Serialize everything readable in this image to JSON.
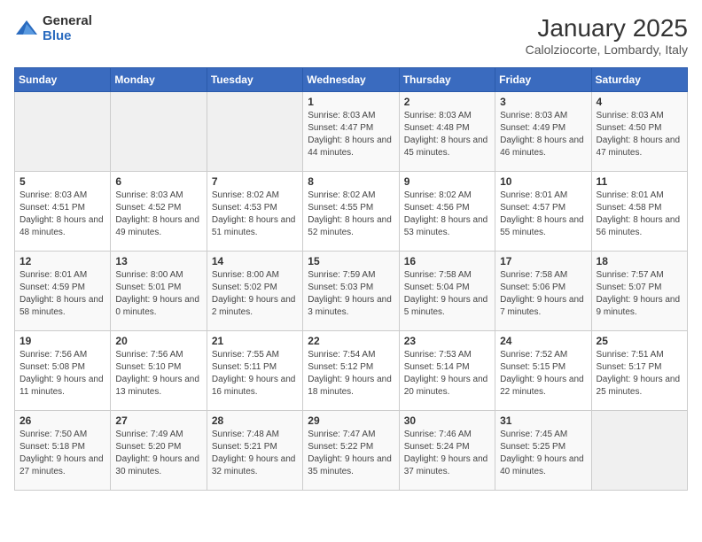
{
  "header": {
    "logo_general": "General",
    "logo_blue": "Blue",
    "month_title": "January 2025",
    "location": "Calolziocorte, Lombardy, Italy"
  },
  "weekdays": [
    "Sunday",
    "Monday",
    "Tuesday",
    "Wednesday",
    "Thursday",
    "Friday",
    "Saturday"
  ],
  "weeks": [
    [
      {
        "day": "",
        "sunrise": "",
        "sunset": "",
        "daylight": ""
      },
      {
        "day": "",
        "sunrise": "",
        "sunset": "",
        "daylight": ""
      },
      {
        "day": "",
        "sunrise": "",
        "sunset": "",
        "daylight": ""
      },
      {
        "day": "1",
        "sunrise": "Sunrise: 8:03 AM",
        "sunset": "Sunset: 4:47 PM",
        "daylight": "Daylight: 8 hours and 44 minutes."
      },
      {
        "day": "2",
        "sunrise": "Sunrise: 8:03 AM",
        "sunset": "Sunset: 4:48 PM",
        "daylight": "Daylight: 8 hours and 45 minutes."
      },
      {
        "day": "3",
        "sunrise": "Sunrise: 8:03 AM",
        "sunset": "Sunset: 4:49 PM",
        "daylight": "Daylight: 8 hours and 46 minutes."
      },
      {
        "day": "4",
        "sunrise": "Sunrise: 8:03 AM",
        "sunset": "Sunset: 4:50 PM",
        "daylight": "Daylight: 8 hours and 47 minutes."
      }
    ],
    [
      {
        "day": "5",
        "sunrise": "Sunrise: 8:03 AM",
        "sunset": "Sunset: 4:51 PM",
        "daylight": "Daylight: 8 hours and 48 minutes."
      },
      {
        "day": "6",
        "sunrise": "Sunrise: 8:03 AM",
        "sunset": "Sunset: 4:52 PM",
        "daylight": "Daylight: 8 hours and 49 minutes."
      },
      {
        "day": "7",
        "sunrise": "Sunrise: 8:02 AM",
        "sunset": "Sunset: 4:53 PM",
        "daylight": "Daylight: 8 hours and 51 minutes."
      },
      {
        "day": "8",
        "sunrise": "Sunrise: 8:02 AM",
        "sunset": "Sunset: 4:55 PM",
        "daylight": "Daylight: 8 hours and 52 minutes."
      },
      {
        "day": "9",
        "sunrise": "Sunrise: 8:02 AM",
        "sunset": "Sunset: 4:56 PM",
        "daylight": "Daylight: 8 hours and 53 minutes."
      },
      {
        "day": "10",
        "sunrise": "Sunrise: 8:01 AM",
        "sunset": "Sunset: 4:57 PM",
        "daylight": "Daylight: 8 hours and 55 minutes."
      },
      {
        "day": "11",
        "sunrise": "Sunrise: 8:01 AM",
        "sunset": "Sunset: 4:58 PM",
        "daylight": "Daylight: 8 hours and 56 minutes."
      }
    ],
    [
      {
        "day": "12",
        "sunrise": "Sunrise: 8:01 AM",
        "sunset": "Sunset: 4:59 PM",
        "daylight": "Daylight: 8 hours and 58 minutes."
      },
      {
        "day": "13",
        "sunrise": "Sunrise: 8:00 AM",
        "sunset": "Sunset: 5:01 PM",
        "daylight": "Daylight: 9 hours and 0 minutes."
      },
      {
        "day": "14",
        "sunrise": "Sunrise: 8:00 AM",
        "sunset": "Sunset: 5:02 PM",
        "daylight": "Daylight: 9 hours and 2 minutes."
      },
      {
        "day": "15",
        "sunrise": "Sunrise: 7:59 AM",
        "sunset": "Sunset: 5:03 PM",
        "daylight": "Daylight: 9 hours and 3 minutes."
      },
      {
        "day": "16",
        "sunrise": "Sunrise: 7:58 AM",
        "sunset": "Sunset: 5:04 PM",
        "daylight": "Daylight: 9 hours and 5 minutes."
      },
      {
        "day": "17",
        "sunrise": "Sunrise: 7:58 AM",
        "sunset": "Sunset: 5:06 PM",
        "daylight": "Daylight: 9 hours and 7 minutes."
      },
      {
        "day": "18",
        "sunrise": "Sunrise: 7:57 AM",
        "sunset": "Sunset: 5:07 PM",
        "daylight": "Daylight: 9 hours and 9 minutes."
      }
    ],
    [
      {
        "day": "19",
        "sunrise": "Sunrise: 7:56 AM",
        "sunset": "Sunset: 5:08 PM",
        "daylight": "Daylight: 9 hours and 11 minutes."
      },
      {
        "day": "20",
        "sunrise": "Sunrise: 7:56 AM",
        "sunset": "Sunset: 5:10 PM",
        "daylight": "Daylight: 9 hours and 13 minutes."
      },
      {
        "day": "21",
        "sunrise": "Sunrise: 7:55 AM",
        "sunset": "Sunset: 5:11 PM",
        "daylight": "Daylight: 9 hours and 16 minutes."
      },
      {
        "day": "22",
        "sunrise": "Sunrise: 7:54 AM",
        "sunset": "Sunset: 5:12 PM",
        "daylight": "Daylight: 9 hours and 18 minutes."
      },
      {
        "day": "23",
        "sunrise": "Sunrise: 7:53 AM",
        "sunset": "Sunset: 5:14 PM",
        "daylight": "Daylight: 9 hours and 20 minutes."
      },
      {
        "day": "24",
        "sunrise": "Sunrise: 7:52 AM",
        "sunset": "Sunset: 5:15 PM",
        "daylight": "Daylight: 9 hours and 22 minutes."
      },
      {
        "day": "25",
        "sunrise": "Sunrise: 7:51 AM",
        "sunset": "Sunset: 5:17 PM",
        "daylight": "Daylight: 9 hours and 25 minutes."
      }
    ],
    [
      {
        "day": "26",
        "sunrise": "Sunrise: 7:50 AM",
        "sunset": "Sunset: 5:18 PM",
        "daylight": "Daylight: 9 hours and 27 minutes."
      },
      {
        "day": "27",
        "sunrise": "Sunrise: 7:49 AM",
        "sunset": "Sunset: 5:20 PM",
        "daylight": "Daylight: 9 hours and 30 minutes."
      },
      {
        "day": "28",
        "sunrise": "Sunrise: 7:48 AM",
        "sunset": "Sunset: 5:21 PM",
        "daylight": "Daylight: 9 hours and 32 minutes."
      },
      {
        "day": "29",
        "sunrise": "Sunrise: 7:47 AM",
        "sunset": "Sunset: 5:22 PM",
        "daylight": "Daylight: 9 hours and 35 minutes."
      },
      {
        "day": "30",
        "sunrise": "Sunrise: 7:46 AM",
        "sunset": "Sunset: 5:24 PM",
        "daylight": "Daylight: 9 hours and 37 minutes."
      },
      {
        "day": "31",
        "sunrise": "Sunrise: 7:45 AM",
        "sunset": "Sunset: 5:25 PM",
        "daylight": "Daylight: 9 hours and 40 minutes."
      },
      {
        "day": "",
        "sunrise": "",
        "sunset": "",
        "daylight": ""
      }
    ]
  ]
}
